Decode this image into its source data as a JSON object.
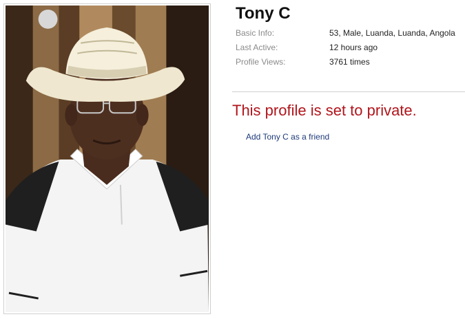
{
  "profile": {
    "name": "Tony C",
    "basic_info_label": "Basic Info:",
    "basic_info_value": "53, Male, Luanda, Luanda, Angola",
    "last_active_label": "Last Active:",
    "last_active_value": "12 hours ago",
    "profile_views_label": "Profile Views:",
    "profile_views_value": "3761 times",
    "private_message": "This profile is set to private.",
    "add_friend_link": "Add Tony C as a friend"
  },
  "colors": {
    "private_message": "#b0151b",
    "link": "#1e3a7a",
    "label": "#8a8a8a"
  }
}
